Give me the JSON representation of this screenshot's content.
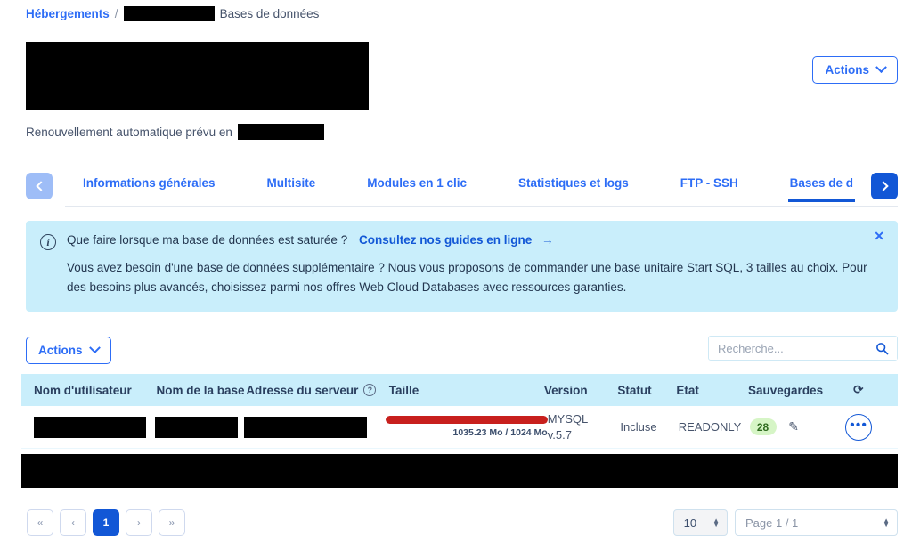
{
  "breadcrumb": {
    "root": "Hébergements",
    "separator": "/",
    "current": "Bases de données"
  },
  "header": {
    "renewal_text": "Renouvellement automatique prévu en",
    "actions_label": "Actions"
  },
  "tabs": {
    "prev_icon": "chevron-left-icon",
    "next_icon": "chevron-right-icon",
    "items": [
      {
        "label": "Informations générales",
        "active": false
      },
      {
        "label": "Multisite",
        "active": false
      },
      {
        "label": "Modules en 1 clic",
        "active": false
      },
      {
        "label": "Statistiques et logs",
        "active": false
      },
      {
        "label": "FTP - SSH",
        "active": false
      },
      {
        "label": "Bases de d",
        "active": true
      }
    ]
  },
  "banner": {
    "icon": "info-circle-icon",
    "heading": "Que faire lorsque ma base de données est saturée ?",
    "link": "Consultez nos guides en ligne",
    "link_arrow": "→",
    "body": "Vous avez besoin d'une base de données supplémentaire ? Nous vous proposons de commander une base unitaire Start SQL, 3 tailles au choix. Pour des besoins plus avancés, choisissez parmi nos offres Web Cloud Databases avec ressources garanties.",
    "close_label": "✕",
    "background_color": "#c9eefb"
  },
  "toolbar": {
    "actions_label": "Actions",
    "search_placeholder": "Recherche...",
    "search_value": "",
    "search_icon": "search-icon"
  },
  "table": {
    "columns": [
      "Nom d'utilisateur",
      "Nom de la base",
      "Adresse du serveur",
      "Taille",
      "Version",
      "Statut",
      "Etat",
      "Sauvegardes"
    ],
    "server_help_icon": "?",
    "refresh_icon": "⟳",
    "header_background": "#c9eefb",
    "rows": [
      {
        "user": "",
        "base": "",
        "server": "",
        "size_text": "1035.23 Mo / 1024 Mo",
        "size_percent": 100,
        "size_color": "#c8201d",
        "version_line1": "MYSQL",
        "version_line2": "v.5.7",
        "statut": "Incluse",
        "etat": "READONLY",
        "backups": "28",
        "backups_color": "#d6f5c6",
        "edit_icon": "edit-icon",
        "menu_icon": "ellipsis-icon"
      }
    ]
  },
  "pagination": {
    "first_label": "«",
    "prev_label": "‹",
    "pages": [
      "1"
    ],
    "active_page": "1",
    "next_label": "›",
    "last_label": "»",
    "page_size": "10",
    "page_indicator": "Page 1 / 1"
  }
}
